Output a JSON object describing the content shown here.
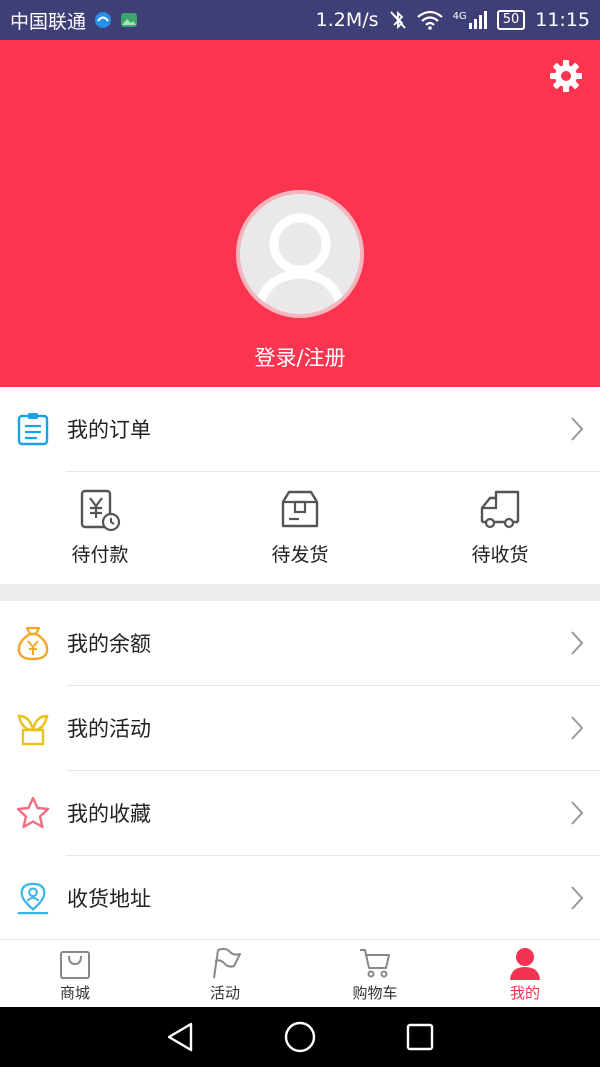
{
  "status_bar": {
    "carrier": "中国联通",
    "speed": "1.2M/s",
    "network": "4G",
    "battery": "50",
    "time": "11:15"
  },
  "header": {
    "login_label": "登录/注册",
    "settings_icon": "gear-icon",
    "avatar_icon": "user-avatar-icon",
    "background_color": "#fb3550"
  },
  "orders": {
    "label": "我的订单",
    "icon": "clipboard-icon",
    "statuses": [
      {
        "label": "待付款",
        "icon": "yuan-bill-clock-icon"
      },
      {
        "label": "待发货",
        "icon": "package-box-icon"
      },
      {
        "label": "待收货",
        "icon": "delivery-truck-icon"
      }
    ]
  },
  "menu": [
    {
      "label": "我的余额",
      "icon": "money-bag-icon"
    },
    {
      "label": "我的活动",
      "icon": "sprout-plant-icon"
    },
    {
      "label": "我的收藏",
      "icon": "star-icon"
    },
    {
      "label": "收货地址",
      "icon": "location-person-icon"
    }
  ],
  "tabs": [
    {
      "label": "商城",
      "icon": "shopping-bag-icon",
      "active": false
    },
    {
      "label": "活动",
      "icon": "flag-icon",
      "active": false
    },
    {
      "label": "购物车",
      "icon": "cart-icon",
      "active": false
    },
    {
      "label": "我的",
      "icon": "person-icon",
      "active": true
    }
  ],
  "colors": {
    "accent": "#f23352",
    "orders_icon": "#1aa1e6",
    "balance_icon": "#f5a623",
    "activity_icon": "#e8c31c",
    "favorite_icon": "#f06f80",
    "address_icon": "#3cb6e8"
  }
}
